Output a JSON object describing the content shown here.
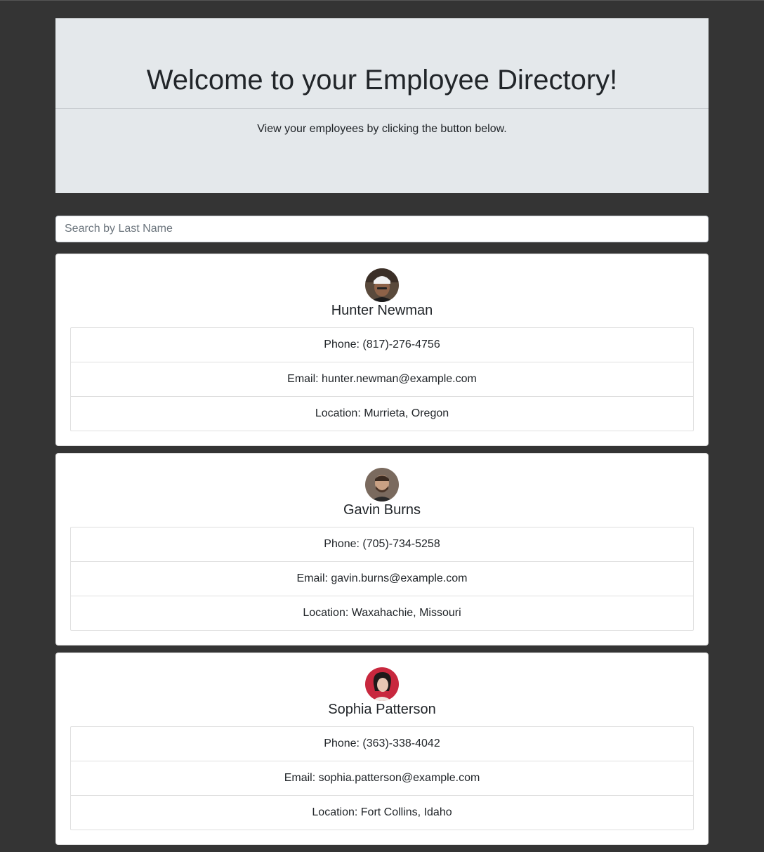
{
  "header": {
    "title": "Welcome to your Employee Directory!",
    "subtitle": "View your employees by clicking the button below."
  },
  "search": {
    "placeholder": "Search by Last Name",
    "value": ""
  },
  "employees": [
    {
      "name": "Hunter Newman",
      "phone": "Phone: (817)-276-4756",
      "email": "Email: hunter.newman@example.com",
      "location": "Location: Murrieta, Oregon",
      "avatar_icon": "avatar-man-white-cap"
    },
    {
      "name": "Gavin Burns",
      "phone": "Phone: (705)-734-5258",
      "email": "Email: gavin.burns@example.com",
      "location": "Location: Waxahachie, Missouri",
      "avatar_icon": "avatar-man-beard"
    },
    {
      "name": "Sophia Patterson",
      "phone": "Phone: (363)-338-4042",
      "email": "Email: sophia.patterson@example.com",
      "location": "Location: Fort Collins, Idaho",
      "avatar_icon": "avatar-woman-red-background"
    }
  ],
  "colors": {
    "page_background": "#343434",
    "jumbotron_background": "#e4e8eb",
    "card_background": "#ffffff"
  }
}
